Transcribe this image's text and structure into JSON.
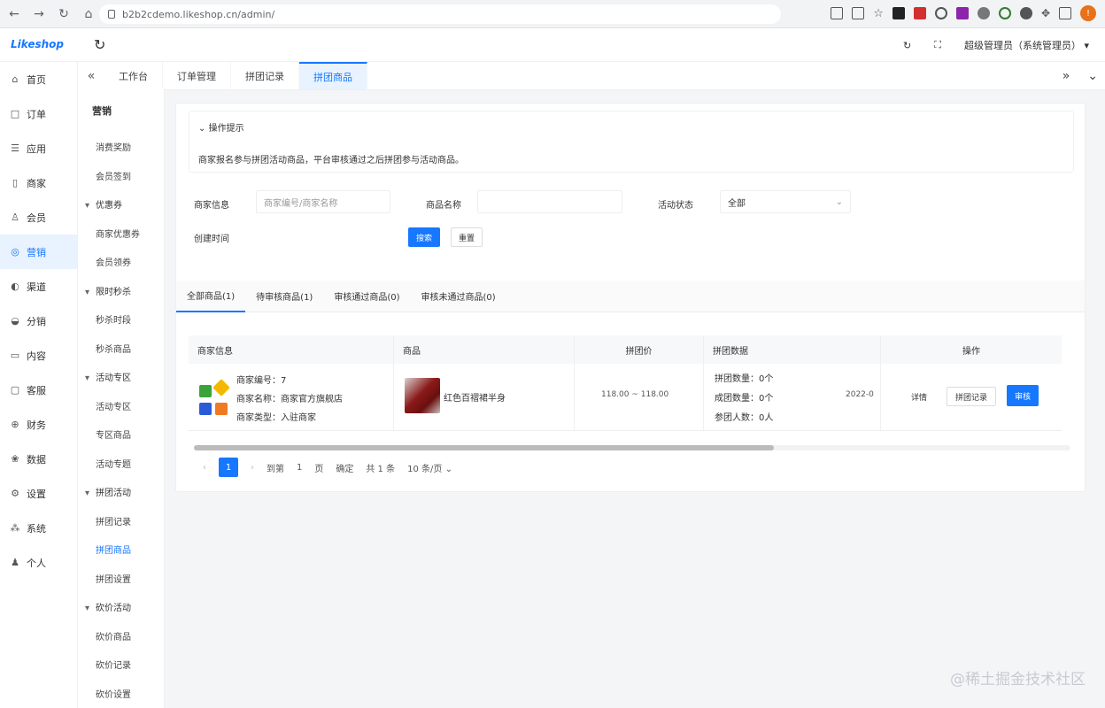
{
  "browser": {
    "url": "b2b2cdemo.likeshop.cn/admin/",
    "profile_initial": "!"
  },
  "header": {
    "logo": "Likeshop",
    "admin_label": "超级管理员（系统管理员）"
  },
  "sidebar": {
    "items": [
      {
        "label": "首页",
        "icon": "home-icon",
        "glyph": "⌂"
      },
      {
        "label": "订单",
        "icon": "order-icon",
        "glyph": "□"
      },
      {
        "label": "应用",
        "icon": "app-icon",
        "glyph": "☰"
      },
      {
        "label": "商家",
        "icon": "shop-icon",
        "glyph": "▯"
      },
      {
        "label": "会员",
        "icon": "user-icon",
        "glyph": "♙"
      },
      {
        "label": "营销",
        "icon": "marketing-icon",
        "glyph": "◎",
        "active": true
      },
      {
        "label": "渠道",
        "icon": "channel-icon",
        "glyph": "◐"
      },
      {
        "label": "分销",
        "icon": "distribution-icon",
        "glyph": "◒"
      },
      {
        "label": "内容",
        "icon": "content-icon",
        "glyph": "▭"
      },
      {
        "label": "客服",
        "icon": "service-icon",
        "glyph": "▢"
      },
      {
        "label": "财务",
        "icon": "finance-icon",
        "glyph": "⊕"
      },
      {
        "label": "数据",
        "icon": "data-icon",
        "glyph": "❀"
      },
      {
        "label": "设置",
        "icon": "settings-icon",
        "glyph": "⚙"
      },
      {
        "label": "系统",
        "icon": "system-icon",
        "glyph": "⁂"
      },
      {
        "label": "个人",
        "icon": "person-icon",
        "glyph": "♟"
      }
    ]
  },
  "subsidebar": {
    "title": "营销",
    "items": [
      {
        "label": "消费奖励",
        "type": "item"
      },
      {
        "label": "会员签到",
        "type": "item"
      },
      {
        "label": "优惠券",
        "type": "group"
      },
      {
        "label": "商家优惠券",
        "type": "item"
      },
      {
        "label": "会员领券",
        "type": "item"
      },
      {
        "label": "限时秒杀",
        "type": "group"
      },
      {
        "label": "秒杀时段",
        "type": "item"
      },
      {
        "label": "秒杀商品",
        "type": "item"
      },
      {
        "label": "活动专区",
        "type": "group"
      },
      {
        "label": "活动专区",
        "type": "item"
      },
      {
        "label": "专区商品",
        "type": "item"
      },
      {
        "label": "活动专题",
        "type": "item"
      },
      {
        "label": "拼团活动",
        "type": "group"
      },
      {
        "label": "拼团记录",
        "type": "item"
      },
      {
        "label": "拼团商品",
        "type": "item",
        "active": true
      },
      {
        "label": "拼团设置",
        "type": "item"
      },
      {
        "label": "砍价活动",
        "type": "group"
      },
      {
        "label": "砍价商品",
        "type": "item"
      },
      {
        "label": "砍价记录",
        "type": "item"
      },
      {
        "label": "砍价设置",
        "type": "item"
      }
    ]
  },
  "tabs": [
    {
      "label": "工作台",
      "active": false
    },
    {
      "label": "订单管理",
      "active": false
    },
    {
      "label": "拼团记录",
      "active": false
    },
    {
      "label": "拼团商品",
      "active": true
    }
  ],
  "tips": {
    "title": "操作提示",
    "text": "商家报名参与拼团活动商品，平台审核通过之后拼团参与活动商品。"
  },
  "filters": {
    "seller_label": "商家信息",
    "seller_placeholder": "商家编号/商家名称",
    "goods_label": "商品名称",
    "goods_placeholder": "",
    "status_label": "活动状态",
    "status_value": "全部",
    "time_label": "创建时间",
    "search_btn": "搜索",
    "reset_btn": "重置"
  },
  "status_tabs": [
    {
      "label": "全部商品(1)",
      "active": true
    },
    {
      "label": "待审核商品(1)",
      "active": false
    },
    {
      "label": "审核通过商品(0)",
      "active": false
    },
    {
      "label": "审核未通过商品(0)",
      "active": false
    }
  ],
  "table": {
    "headers": [
      "商家信息",
      "商品",
      "拼团价",
      "拼团数据",
      "操作"
    ],
    "row": {
      "seller_lines": [
        "商家编号：7",
        "商家名称：商家官方旗舰店",
        "商家类型：入驻商家"
      ],
      "goods_name": "红色百褶裙半身",
      "price": "118.00 ~ 118.00",
      "data_lines": [
        "拼团数量：0个",
        "成团数量：0个",
        "参团人数：0人"
      ],
      "date": "2022-0",
      "actions": [
        "详情",
        "拼团记录",
        "审核"
      ]
    }
  },
  "pagination": {
    "page": "1",
    "goto_label": "到第",
    "goto_value": "1",
    "page_unit": "页",
    "confirm": "确定",
    "total": "共 1 条",
    "page_size": "10 条/页"
  },
  "colors": {
    "primary": "#1677ff",
    "logo_green": "#3aa43a",
    "logo_yellow": "#f5b800",
    "logo_blue": "#2a5bd7",
    "logo_orange": "#f07a22"
  },
  "watermark": "@稀土掘金技术社区"
}
